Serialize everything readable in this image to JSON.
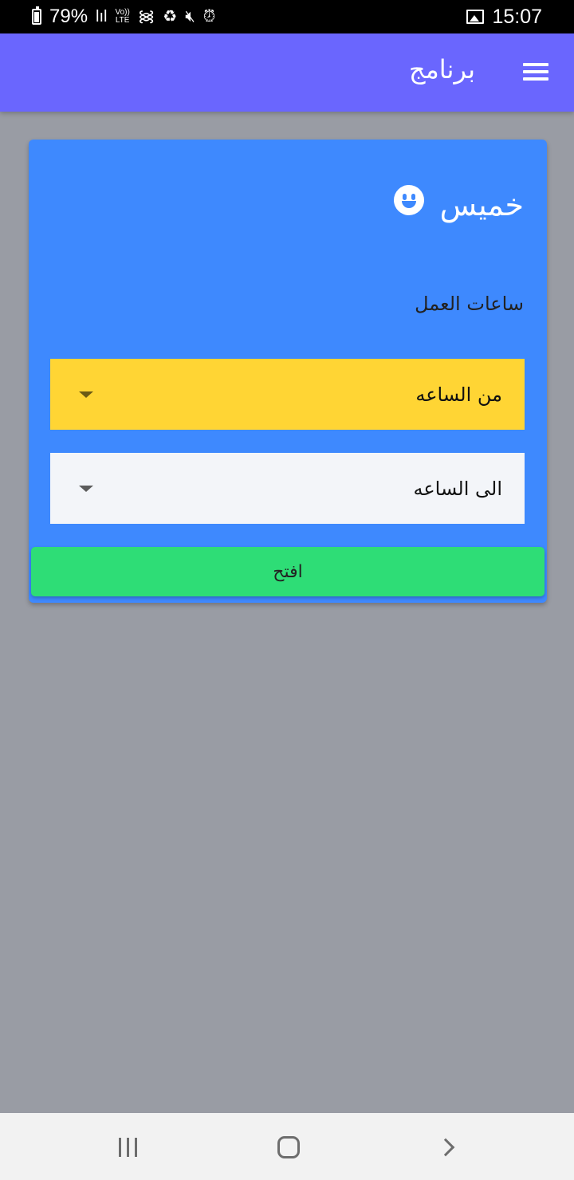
{
  "status_bar": {
    "battery_percent": "79%",
    "signal_icon": "signal-bars-icon",
    "volte_label": "Vo))",
    "lte_label": "LTE",
    "icons": [
      "wifi-icon",
      "recycle-icon",
      "mute-icon",
      "alarm-icon",
      "gallery-icon"
    ],
    "time": "15:07"
  },
  "app_bar": {
    "title": "برنامج",
    "menu_icon": "hamburger-menu-icon",
    "background_color": "#6a66fe"
  },
  "card": {
    "day_title": "خميس",
    "day_icon": "smile-icon",
    "hours_label": "ساعات العمل",
    "from_select": {
      "value": "من الساعه",
      "color": "#ffd534"
    },
    "to_select": {
      "value": "الى الساعه",
      "color": "#f3f5f9"
    },
    "open_button_label": "افتح",
    "background_color": "#3e89fe",
    "button_color": "#2edd76"
  },
  "nav_bar": {
    "icons": [
      "recent-apps-icon",
      "home-icon",
      "back-icon"
    ]
  }
}
